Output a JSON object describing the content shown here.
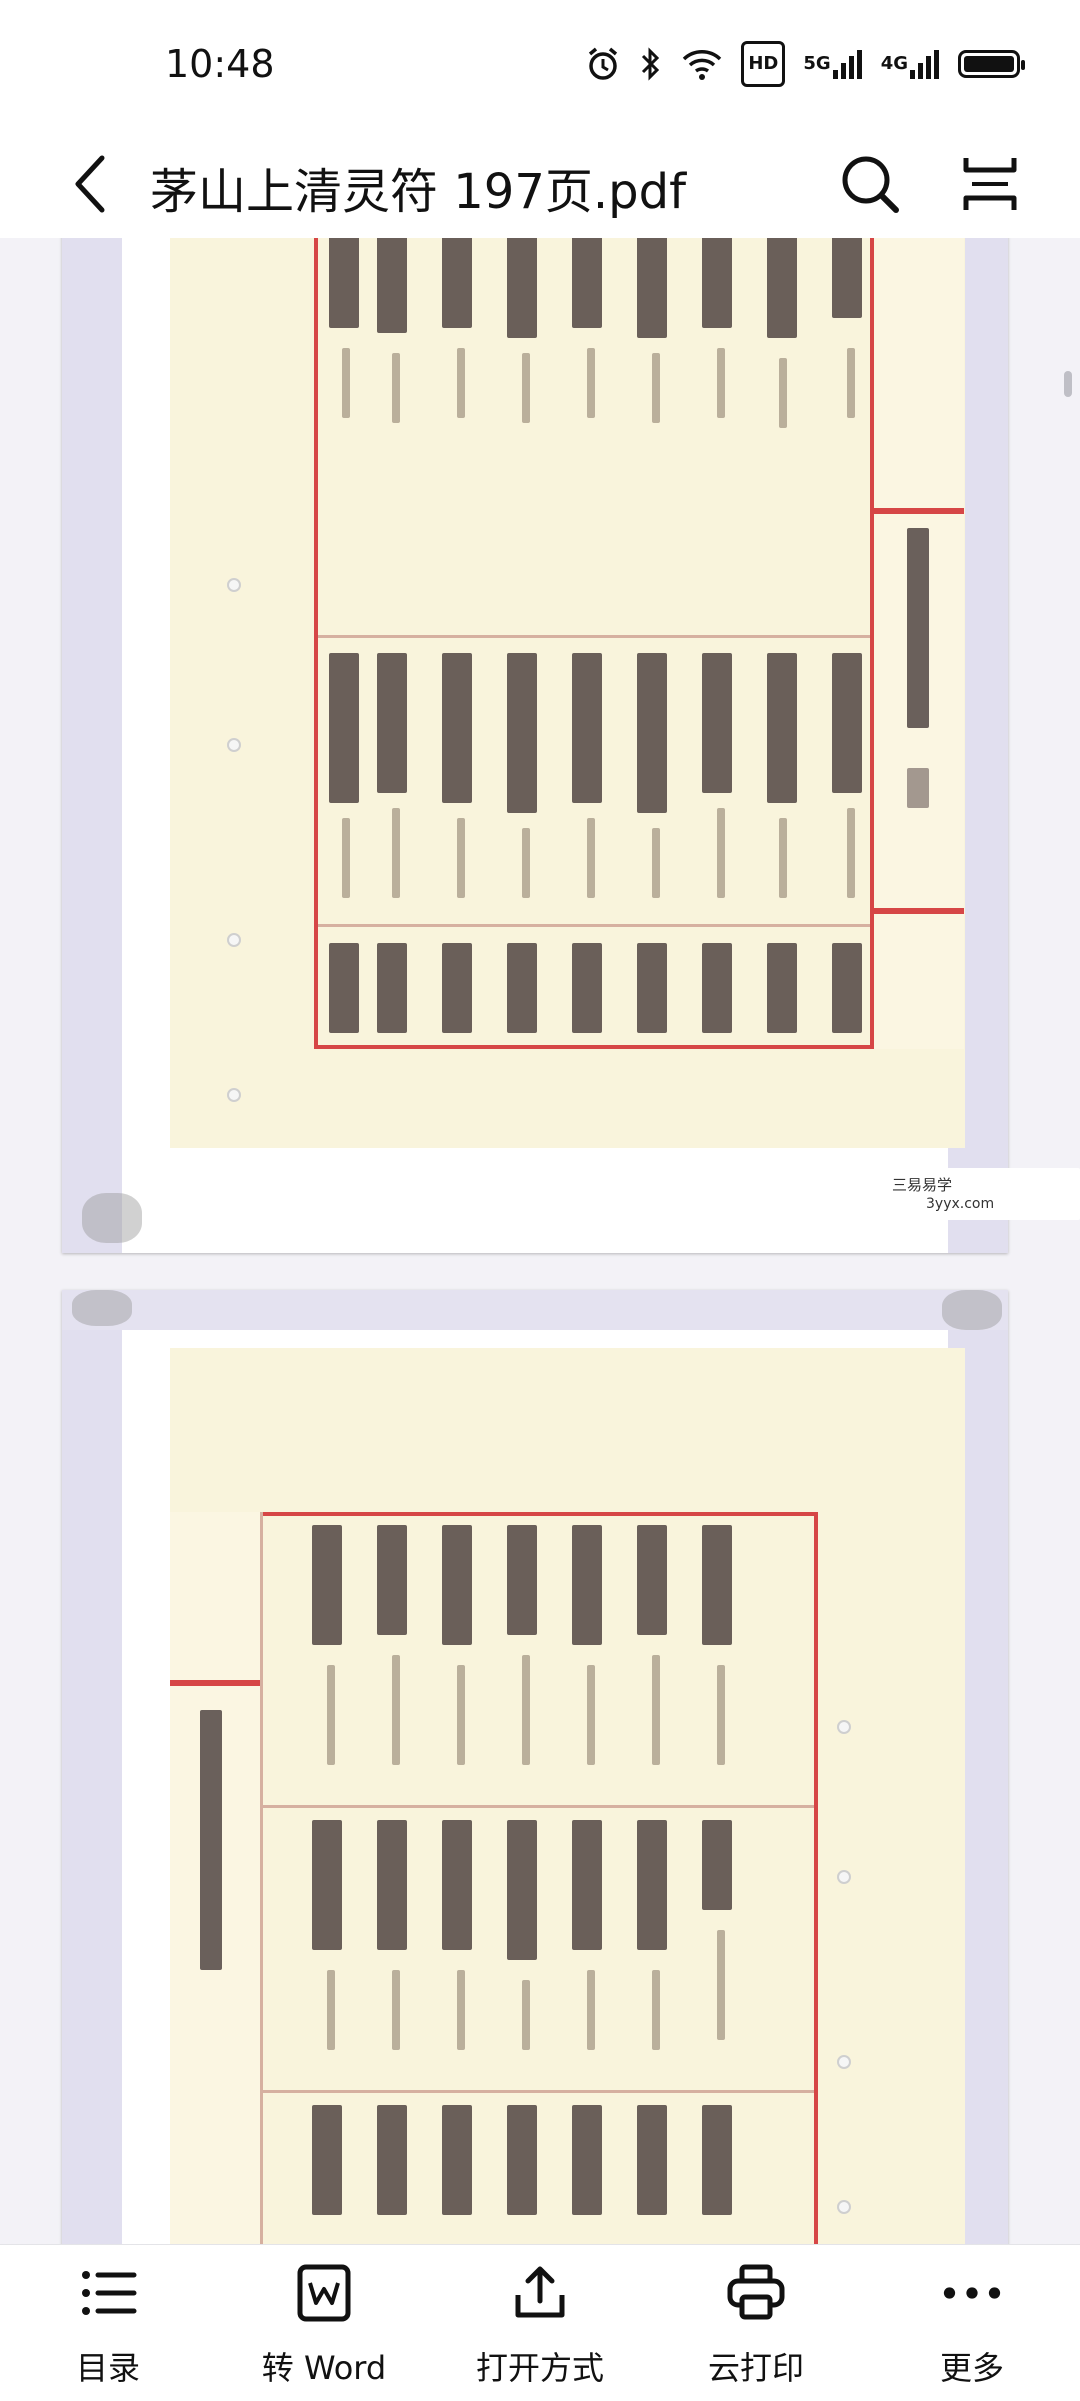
{
  "status_bar": {
    "time": "10:48",
    "hd_label": "HD",
    "net_5g": "5G",
    "net_4g": "4G",
    "icons": [
      "alarm-icon",
      "bluetooth-icon",
      "wifi-icon",
      "hd-voice-icon",
      "signal-5g-icon",
      "signal-4g-icon",
      "battery-icon"
    ]
  },
  "header": {
    "title": "茅山上清灵符 197页.pdf",
    "back_icon": "chevron-left-icon",
    "search_icon": "search-icon",
    "fit_icon": "fit-width-icon"
  },
  "viewer": {
    "watermark_line1": "三易易学",
    "watermark_line2": "3yyx.com"
  },
  "toolbar": {
    "items": [
      {
        "label": "目录",
        "icon": "list-icon"
      },
      {
        "label": "转 Word",
        "icon": "word-icon"
      },
      {
        "label": "打开方式",
        "icon": "share-icon"
      },
      {
        "label": "云打印",
        "icon": "printer-icon"
      },
      {
        "label": "更多",
        "icon": "more-icon"
      }
    ]
  },
  "colors": {
    "accent_red": "#d64646",
    "paper": "#f9f4dc",
    "background": "#f3f2f7"
  }
}
